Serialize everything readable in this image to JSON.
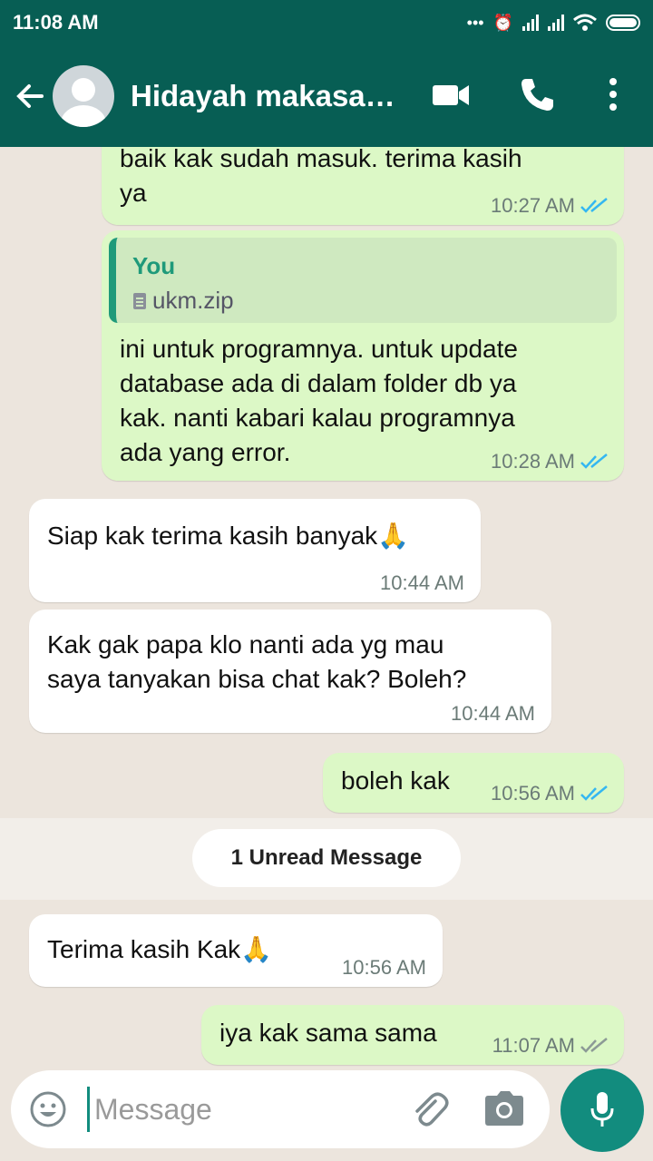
{
  "status_bar": {
    "time": "11:08 AM"
  },
  "header": {
    "contact_name": "Hidayah makasa…",
    "icons": [
      "back-arrow-icon",
      "avatar",
      "video-call-icon",
      "phone-icon",
      "more-options-icon"
    ]
  },
  "messages": [
    {
      "direction": "outgoing",
      "text_lines": [
        "baik kak sudah masuk. terima kasih",
        "ya"
      ],
      "time": "10:27 AM",
      "status": "read"
    },
    {
      "direction": "outgoing",
      "quote": {
        "name": "You",
        "file": "ukm.zip"
      },
      "text_lines": [
        "ini untuk programnya. untuk update",
        "database ada di dalam folder db ya",
        "kak. nanti kabari kalau programnya",
        "ada yang error."
      ],
      "time": "10:28 AM",
      "status": "read"
    },
    {
      "direction": "incoming",
      "text_lines": [
        "Siap kak terima kasih banyak🙏"
      ],
      "time": "10:44 AM"
    },
    {
      "direction": "incoming",
      "text_lines": [
        "Kak gak papa klo nanti ada yg mau",
        "saya tanyakan bisa chat kak? Boleh?"
      ],
      "time": "10:44 AM"
    },
    {
      "direction": "outgoing",
      "text_lines": [
        "boleh kak"
      ],
      "time": "10:56 AM",
      "status": "read"
    },
    {
      "direction": "incoming",
      "text_lines": [
        "Terima kasih Kak🙏"
      ],
      "time": "10:56 AM"
    },
    {
      "direction": "outgoing",
      "text_lines": [
        "iya kak sama sama"
      ],
      "time": "11:07 AM",
      "status": "delivered"
    }
  ],
  "unread_banner": "1 Unread Message",
  "input": {
    "placeholder": "Message"
  },
  "colors": {
    "header": "#075e54",
    "outgoing_bubble": "#dcf8c6",
    "incoming_bubble": "#ffffff",
    "read_ticks": "#34b7f1",
    "delivered_ticks": "#8c9a96",
    "accent": "#128c7e"
  }
}
